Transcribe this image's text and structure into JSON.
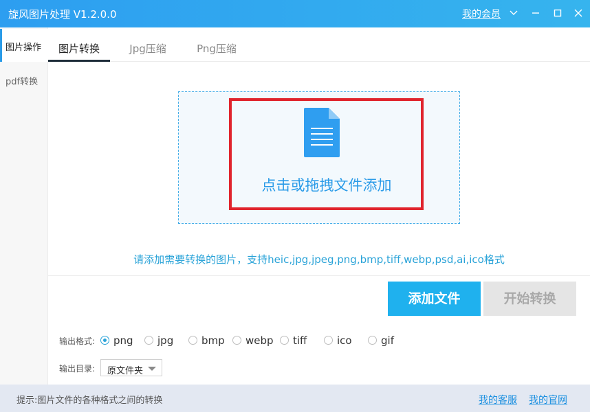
{
  "app": {
    "title": "旋风图片处理 V1.2.0.0",
    "member_link": "我的会员"
  },
  "sidebar": {
    "items": [
      {
        "label": "图片操作",
        "active": true
      },
      {
        "label": "pdf转换",
        "active": false
      }
    ]
  },
  "tabs": [
    {
      "label": "图片转换",
      "active": true
    },
    {
      "label": "Jpg压缩",
      "active": false
    },
    {
      "label": "Png压缩",
      "active": false
    }
  ],
  "dropzone": {
    "label": "点击或拖拽文件添加",
    "icon": "document-icon"
  },
  "support_text": "请添加需要转换的图片，支持heic,jpg,jpeg,png,bmp,tiff,webp,psd,ai,ico格式",
  "buttons": {
    "add": "添加文件",
    "start": "开始转换"
  },
  "output_format": {
    "label": "输出格式:",
    "options": [
      "png",
      "jpg",
      "bmp",
      "webp",
      "tiff",
      "ico",
      "gif"
    ],
    "selected": "png"
  },
  "output_dir": {
    "label": "输出目录:",
    "value": "原文件夹"
  },
  "status": {
    "text": "提示:图片文件的各种格式之间的转换",
    "links": [
      "我的客服",
      "我的官网"
    ]
  },
  "colors": {
    "titlebar": "#2d9ef0",
    "accent": "#1fb1ee",
    "highlight": "#e0242d",
    "statusbar": "#e3e8f2"
  }
}
